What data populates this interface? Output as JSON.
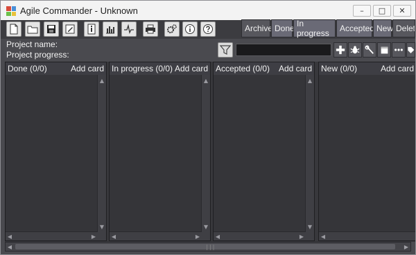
{
  "window": {
    "title": "Agile Commander - Unknown",
    "controls": {
      "minimize": "–",
      "maximize": "□",
      "close": "✕"
    }
  },
  "toolbar": {
    "icons": [
      "new-file-icon",
      "open-folder-icon",
      "save-icon",
      "edit-icon",
      "info-page-icon",
      "bar-chart-icon",
      "pulse-icon",
      "print-icon",
      "settings-gears-icon",
      "about-icon",
      "help-icon"
    ],
    "filter_tabs": [
      "Archive",
      "Done",
      "In progress",
      "Accepted",
      "New",
      "Delet"
    ]
  },
  "project": {
    "name_label": "Project name:",
    "progress_label": "Project progress:"
  },
  "filter": {
    "value": "",
    "actions": [
      "add-icon",
      "bug-icon",
      "wrench-icon",
      "note-icon",
      "more-icon",
      "tag-icon"
    ]
  },
  "columns": [
    {
      "title": "Done (0/0)",
      "add_label": "Add card"
    },
    {
      "title": "In progress (0/0)",
      "add_label": "Add card"
    },
    {
      "title": "Accepted (0/0)",
      "add_label": "Add card"
    },
    {
      "title": "New (0/0)",
      "add_label": "Add card"
    }
  ]
}
